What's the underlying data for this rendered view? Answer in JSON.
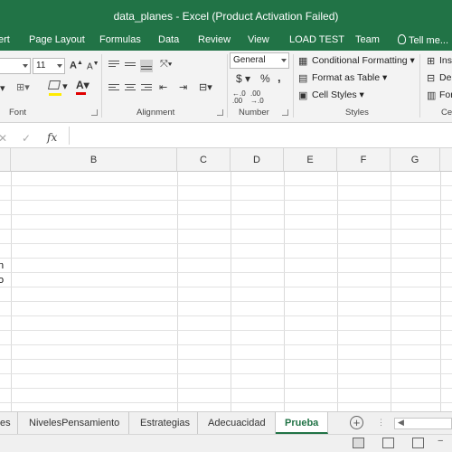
{
  "window": {
    "title": "data_planes - Excel (Product Activation Failed)"
  },
  "ribbon_tabs": [
    "ert",
    "Page Layout",
    "Formulas",
    "Data",
    "Review",
    "View",
    "LOAD TEST",
    "Team"
  ],
  "tell_me": "Tell me...",
  "font": {
    "size": "11"
  },
  "number_format": "General",
  "groups": {
    "font": "Font",
    "alignment": "Alignment",
    "number": "Number",
    "styles": "Styles",
    "cells": "Ce"
  },
  "styles": {
    "conditional": "Conditional Formatting",
    "format_table": "Format as Table",
    "cell_styles": "Cell Styles"
  },
  "cells": {
    "insert": "Ins",
    "delete": "Del",
    "format": "For"
  },
  "number_symbols": {
    "currency": "$",
    "percent": "%",
    "comma": ","
  },
  "columns": [
    "B",
    "C",
    "D",
    "E",
    "F",
    "G"
  ],
  "cells_a": {
    "row1": "n",
    "row2": "o"
  },
  "sheets": [
    "es",
    "NivelesPensamiento",
    "Estrategias",
    "Adecuacidad",
    "Prueba"
  ],
  "active_sheet": "Prueba",
  "colors": {
    "excel_green": "#217346"
  }
}
